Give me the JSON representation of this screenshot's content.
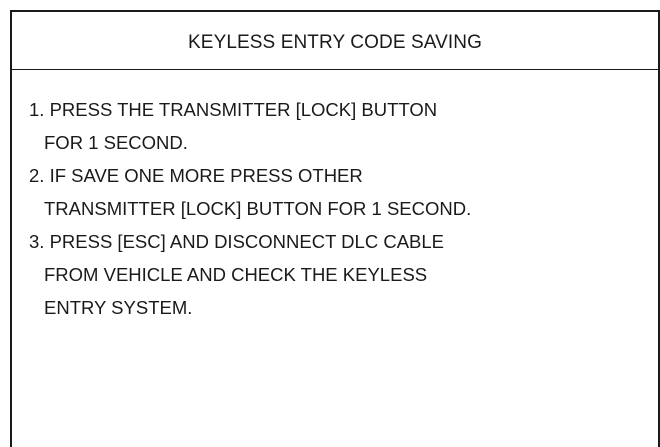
{
  "screen": {
    "title": "KEYLESS ENTRY CODE SAVING",
    "steps": [
      {
        "lines": [
          "1.  PRESS THE TRANSMITTER  [LOCK]  BUTTON",
          "FOR 1 SECOND."
        ]
      },
      {
        "lines": [
          "2. IF SAVE ONE MORE PRESS OTHER",
          "TRANSMITTER [LOCK] BUTTON FOR 1 SECOND."
        ]
      },
      {
        "lines": [
          "3. PRESS [ESC] AND DISCONNECT DLC CABLE",
          "FROM VEHICLE AND CHECK THE KEYLESS",
          "ENTRY SYSTEM."
        ]
      }
    ]
  }
}
